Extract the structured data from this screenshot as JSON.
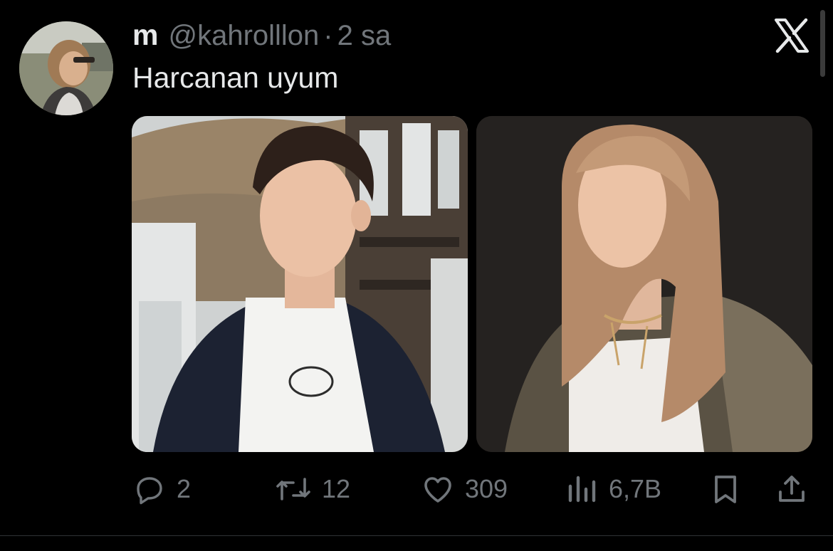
{
  "tweet": {
    "display_name": "m",
    "handle": "@kahrolllon",
    "separator": "·",
    "time": "2 sa",
    "text": "Harcanan uyum"
  },
  "media": [
    {
      "alt": "young man with curly dark hair in white t-shirt and dark jacket"
    },
    {
      "alt": "young woman with long light brown hair and satin jacket"
    }
  ],
  "actions": {
    "replies": "2",
    "reposts": "12",
    "likes": "309",
    "views": "6,7B"
  },
  "icons": {
    "reply": "reply-icon",
    "repost": "repost-icon",
    "like": "heart-icon",
    "views": "views-icon",
    "bookmark": "bookmark-icon",
    "share": "share-icon",
    "brand": "x-logo-icon"
  },
  "colors": {
    "background": "#000000",
    "text": "#e7e9ea",
    "muted": "#71767b"
  }
}
